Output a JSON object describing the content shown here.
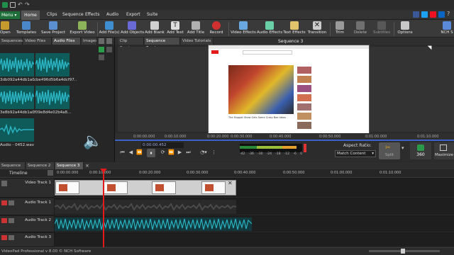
{
  "menu": {
    "dropdown": "Menu",
    "tabs": [
      "Home",
      "Clips",
      "Sequence",
      "Effects",
      "Audio",
      "Export",
      "Suite"
    ]
  },
  "toolbar": {
    "buttons": [
      "Open",
      "Templates",
      "Save Project",
      "Export Video",
      "Add File(s)",
      "Add Objects",
      "Add Blank",
      "Add Text",
      "Add Title",
      "Record",
      "Video Effects",
      "Audio Effects",
      "Text Effects",
      "Transition",
      "Trim",
      "Delete",
      "Subtitles",
      "Options",
      "NCH S"
    ]
  },
  "media_panel": {
    "tabs": [
      "Sequences",
      "Video Files",
      "Audio Files",
      "Images"
    ],
    "items": [
      {
        "name": "3db092a44db1a0..."
      },
      {
        "name": "cbe496d5b6a4dcf97..."
      },
      {
        "name": "3e8b92a44db1a0..."
      },
      {
        "name": "f09e8d4e02b4a8..."
      },
      {
        "name": "Audio - 0452.wav"
      }
    ]
  },
  "preview": {
    "tabs": [
      "Clip Preview",
      "Sequence Preview",
      "Video Tutorials"
    ],
    "title": "Sequence 3",
    "timecode": "0:00:00.452",
    "seek_marks": [
      "0:00:00.000",
      "0:00:10.000",
      "0:00:20.000",
      "0:00:30.000",
      "0:00:40.000",
      "0:00:50.000",
      "0:01:00.000",
      "0:01:10.000"
    ],
    "meter_labels": [
      "-42",
      "-36",
      "-30",
      "-24",
      "-18",
      "-12",
      "-6",
      "0"
    ],
    "aspect_label": "Aspect Ratio:",
    "aspect_value": "Match Content",
    "split_label": "Split",
    "btn_360": "360",
    "maximize_label": "Maximize"
  },
  "timeline": {
    "seq_tabs": [
      "Sequence 1",
      "Sequence 2",
      "Sequence 3"
    ],
    "label": "Timeline",
    "ruler_marks": [
      "0:00:00.000",
      "0:00:10.000",
      "0:00:20.000",
      "0:00:30.000",
      "0:00:40.000",
      "0:00:50.000",
      "0:01:00.000",
      "0:01:10.000"
    ],
    "tracks": [
      "Video Track 1",
      "Audio Track 1",
      "Audio Track 2",
      "Audio Track 3"
    ]
  },
  "video_content": {
    "title": "The Muppet Show Gets Some Crazy Bad Ideas"
  },
  "status": "VideoPad Professional v 8.00 © NCH Software",
  "colors": {
    "accent_teal": "#0e5b5a",
    "waveform": "#2bb3c2",
    "playhead": "#e21a1a",
    "seek_blue": "#3b63c6",
    "menu_green": "#1f6f3a"
  }
}
